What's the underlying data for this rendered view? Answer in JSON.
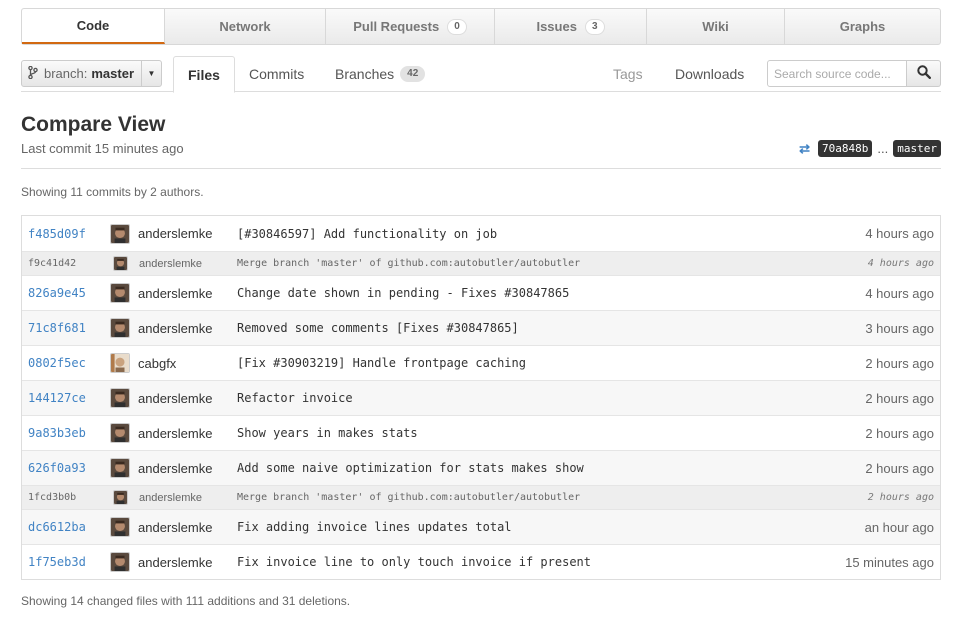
{
  "topnav": [
    {
      "label": "Code",
      "count": null
    },
    {
      "label": "Network",
      "count": null
    },
    {
      "label": "Pull Requests",
      "count": "0"
    },
    {
      "label": "Issues",
      "count": "3"
    },
    {
      "label": "Wiki",
      "count": null
    },
    {
      "label": "Graphs",
      "count": null
    }
  ],
  "branch": {
    "prefix": "branch:",
    "name": "master"
  },
  "subnav": {
    "files": "Files",
    "commits": "Commits",
    "branches": "Branches",
    "branches_count": "42",
    "tags": "Tags",
    "downloads": "Downloads"
  },
  "search": {
    "placeholder": "Search source code..."
  },
  "header": {
    "title": "Compare View",
    "subtitle": "Last commit 15 minutes ago",
    "from_sha": "70a848b",
    "dots": "...",
    "to_ref": "master"
  },
  "summary_commits": "Showing 11 commits by 2 authors.",
  "commits": [
    {
      "sha": "f485d09f",
      "author": "anderslemke",
      "message": "[#30846597] Add functionality on job",
      "time": "4 hours ago",
      "merge": false,
      "avatar": "a"
    },
    {
      "sha": "f9c41d42",
      "author": "anderslemke",
      "message": "Merge branch 'master' of github.com:autobutler/autobutler",
      "time": "4 hours ago",
      "merge": true,
      "avatar": "a"
    },
    {
      "sha": "826a9e45",
      "author": "anderslemke",
      "message": "Change date shown in pending - Fixes #30847865",
      "time": "4 hours ago",
      "merge": false,
      "avatar": "a"
    },
    {
      "sha": "71c8f681",
      "author": "anderslemke",
      "message": "Removed some comments [Fixes #30847865]",
      "time": "3 hours ago",
      "merge": false,
      "avatar": "a"
    },
    {
      "sha": "0802f5ec",
      "author": "cabgfx",
      "message": "[Fix #30903219] Handle frontpage caching",
      "time": "2 hours ago",
      "merge": false,
      "avatar": "c"
    },
    {
      "sha": "144127ce",
      "author": "anderslemke",
      "message": "Refactor invoice",
      "time": "2 hours ago",
      "merge": false,
      "avatar": "a"
    },
    {
      "sha": "9a83b3eb",
      "author": "anderslemke",
      "message": "Show years in makes stats",
      "time": "2 hours ago",
      "merge": false,
      "avatar": "a"
    },
    {
      "sha": "626f0a93",
      "author": "anderslemke",
      "message": "Add some naive optimization for stats makes show",
      "time": "2 hours ago",
      "merge": false,
      "avatar": "a"
    },
    {
      "sha": "1fcd3b0b",
      "author": "anderslemke",
      "message": "Merge branch 'master' of github.com:autobutler/autobutler",
      "time": "2 hours ago",
      "merge": true,
      "avatar": "a"
    },
    {
      "sha": "dc6612ba",
      "author": "anderslemke",
      "message": "Fix adding invoice lines updates total",
      "time": "an hour ago",
      "merge": false,
      "avatar": "a"
    },
    {
      "sha": "1f75eb3d",
      "author": "anderslemke",
      "message": "Fix invoice line to only touch invoice if present",
      "time": "15 minutes ago",
      "merge": false,
      "avatar": "a"
    }
  ],
  "summary_files": "Showing 14 changed files with 111 additions and 31 deletions.",
  "colors": {
    "accent": "#d26911",
    "link": "#4183c4"
  }
}
